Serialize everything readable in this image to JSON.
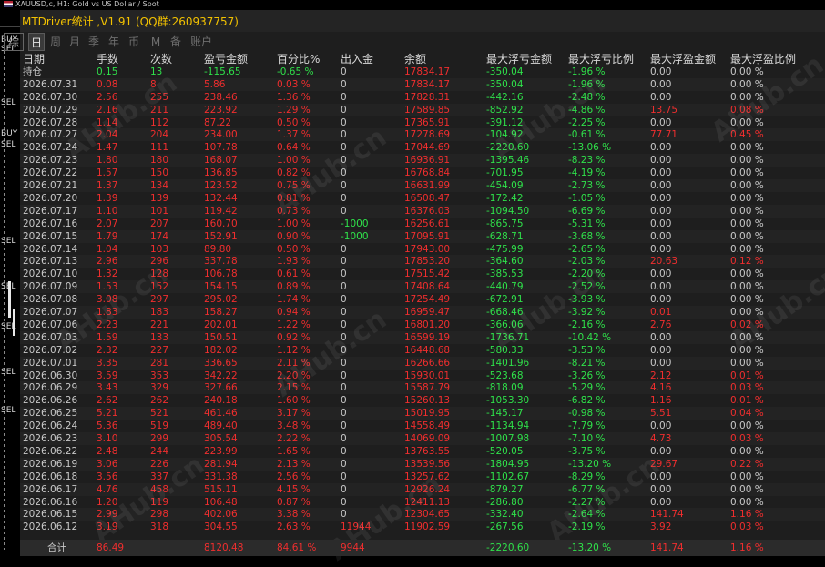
{
  "chart_header": "XAUUSD,c, H1:  Gold vs US Dollar / Spot",
  "side_labels": [
    "BUY",
    "SEL",
    "SEL",
    "BUY",
    "SEL",
    "SEL",
    "SEL",
    "SEL",
    "SEL",
    "SEL"
  ],
  "app_title": "MTDriver统计 ,V1.91 (QQ群:260937757)",
  "tabs": [
    "综",
    "日",
    "周",
    "月",
    "季",
    "年",
    "币",
    "M",
    "备",
    "账户"
  ],
  "active_tab": "日",
  "columns": [
    "日期",
    "手数",
    "次数",
    "盈亏金额",
    "百分比%",
    "出入金",
    "余额",
    "最大浮亏金额",
    "最大浮亏比例",
    "最大浮盈金额",
    "最大浮盈比例"
  ],
  "rows": [
    [
      "持仓",
      "0.15",
      "13",
      "-115.65",
      "-0.65 %",
      "0",
      "17834.17",
      "-350.04",
      "-1.96 %",
      "0.00",
      "0.00 %"
    ],
    [
      "2026.07.31",
      "0.08",
      "8",
      "5.86",
      "0.03 %",
      "0",
      "17834.17",
      "-350.04",
      "-1.96 %",
      "0.00",
      "0.00 %"
    ],
    [
      "2026.07.30",
      "2.56",
      "255",
      "238.46",
      "1.36 %",
      "0",
      "17828.31",
      "-442.16",
      "-2.48 %",
      "0.00",
      "0.00 %"
    ],
    [
      "2026.07.29",
      "2.16",
      "211",
      "223.92",
      "1.29 %",
      "0",
      "17589.85",
      "-852.92",
      "-4.86 %",
      "13.75",
      "0.08 %"
    ],
    [
      "2026.07.28",
      "1.14",
      "112",
      "87.22",
      "0.50 %",
      "0",
      "17365.91",
      "-391.12",
      "-2.25 %",
      "0.00",
      "0.00 %"
    ],
    [
      "2026.07.27",
      "2.04",
      "204",
      "234.00",
      "1.37 %",
      "0",
      "17278.69",
      "-104.92",
      "-0.61 %",
      "77.71",
      "0.45 %"
    ],
    [
      "2026.07.24",
      "1.47",
      "111",
      "107.78",
      "0.64 %",
      "0",
      "17044.69",
      "-2220.60",
      "-13.06 %",
      "0.00",
      "0.00 %"
    ],
    [
      "2026.07.23",
      "1.80",
      "180",
      "168.07",
      "1.00 %",
      "0",
      "16936.91",
      "-1395.46",
      "-8.23 %",
      "0.00",
      "0.00 %"
    ],
    [
      "2026.07.22",
      "1.57",
      "150",
      "136.85",
      "0.82 %",
      "0",
      "16768.84",
      "-701.95",
      "-4.19 %",
      "0.00",
      "0.00 %"
    ],
    [
      "2026.07.21",
      "1.37",
      "134",
      "123.52",
      "0.75 %",
      "0",
      "16631.99",
      "-454.09",
      "-2.73 %",
      "0.00",
      "0.00 %"
    ],
    [
      "2026.07.20",
      "1.39",
      "139",
      "132.44",
      "0.81 %",
      "0",
      "16508.47",
      "-172.42",
      "-1.05 %",
      "0.00",
      "0.00 %"
    ],
    [
      "2026.07.17",
      "1.10",
      "101",
      "119.42",
      "0.73 %",
      "0",
      "16376.03",
      "-1094.50",
      "-6.69 %",
      "0.00",
      "0.00 %"
    ],
    [
      "2026.07.16",
      "2.07",
      "207",
      "160.70",
      "1.00 %",
      "-1000",
      "16256.61",
      "-865.75",
      "-5.31 %",
      "0.00",
      "0.00 %"
    ],
    [
      "2026.07.15",
      "1.79",
      "174",
      "152.91",
      "0.90 %",
      "-1000",
      "17095.91",
      "-628.71",
      "-3.68 %",
      "0.00",
      "0.00 %"
    ],
    [
      "2026.07.14",
      "1.04",
      "103",
      "89.80",
      "0.50 %",
      "0",
      "17943.00",
      "-475.99",
      "-2.65 %",
      "0.00",
      "0.00 %"
    ],
    [
      "2026.07.13",
      "2.96",
      "296",
      "337.78",
      "1.93 %",
      "0",
      "17853.20",
      "-364.60",
      "-2.03 %",
      "20.63",
      "0.12 %"
    ],
    [
      "2026.07.10",
      "1.32",
      "128",
      "106.78",
      "0.61 %",
      "0",
      "17515.42",
      "-385.53",
      "-2.20 %",
      "0.00",
      "0.00 %"
    ],
    [
      "2026.07.09",
      "1.53",
      "152",
      "154.15",
      "0.89 %",
      "0",
      "17408.64",
      "-440.79",
      "-2.52 %",
      "0.00",
      "0.00 %"
    ],
    [
      "2026.07.08",
      "3.08",
      "297",
      "295.02",
      "1.74 %",
      "0",
      "17254.49",
      "-672.91",
      "-3.93 %",
      "0.00",
      "0.00 %"
    ],
    [
      "2026.07.07",
      "1.83",
      "183",
      "158.27",
      "0.94 %",
      "0",
      "16959.47",
      "-668.46",
      "-3.92 %",
      "0.01",
      "0.00 %"
    ],
    [
      "2026.07.06",
      "2.23",
      "221",
      "202.01",
      "1.22 %",
      "0",
      "16801.20",
      "-366.06",
      "-2.16 %",
      "2.76",
      "0.02 %"
    ],
    [
      "2026.07.03",
      "1.59",
      "133",
      "150.51",
      "0.92 %",
      "0",
      "16599.19",
      "-1736.71",
      "-10.42 %",
      "0.00",
      "0.00 %"
    ],
    [
      "2026.07.02",
      "2.32",
      "227",
      "182.02",
      "1.12 %",
      "0",
      "16448.68",
      "-580.33",
      "-3.53 %",
      "0.00",
      "0.00 %"
    ],
    [
      "2026.07.01",
      "3.35",
      "281",
      "336.65",
      "2.11 %",
      "0",
      "16266.66",
      "-1401.96",
      "-8.21 %",
      "0.00",
      "0.00 %"
    ],
    [
      "2026.06.30",
      "3.59",
      "353",
      "342.22",
      "2.20 %",
      "0",
      "15930.01",
      "-523.68",
      "-3.26 %",
      "2.12",
      "0.01 %"
    ],
    [
      "2026.06.29",
      "3.43",
      "329",
      "327.66",
      "2.15 %",
      "0",
      "15587.79",
      "-818.09",
      "-5.29 %",
      "4.16",
      "0.03 %"
    ],
    [
      "2026.06.26",
      "2.62",
      "262",
      "240.18",
      "1.60 %",
      "0",
      "15260.13",
      "-1053.30",
      "-6.82 %",
      "1.16",
      "0.01 %"
    ],
    [
      "2026.06.25",
      "5.21",
      "521",
      "461.46",
      "3.17 %",
      "0",
      "15019.95",
      "-145.17",
      "-0.98 %",
      "5.51",
      "0.04 %"
    ],
    [
      "2026.06.24",
      "5.36",
      "519",
      "489.40",
      "3.48 %",
      "0",
      "14558.49",
      "-1134.94",
      "-7.79 %",
      "0.00",
      "0.00 %"
    ],
    [
      "2026.06.23",
      "3.10",
      "299",
      "305.54",
      "2.22 %",
      "0",
      "14069.09",
      "-1007.98",
      "-7.10 %",
      "4.73",
      "0.03 %"
    ],
    [
      "2026.06.22",
      "2.48",
      "244",
      "223.99",
      "1.65 %",
      "0",
      "13763.55",
      "-520.05",
      "-3.75 %",
      "0.00",
      "0.00 %"
    ],
    [
      "2026.06.19",
      "3.06",
      "226",
      "281.94",
      "2.13 %",
      "0",
      "13539.56",
      "-1804.95",
      "-13.20 %",
      "29.67",
      "0.22 %"
    ],
    [
      "2026.06.18",
      "3.56",
      "337",
      "331.38",
      "2.56 %",
      "0",
      "13257.62",
      "-1102.67",
      "-8.29 %",
      "0.00",
      "0.00 %"
    ],
    [
      "2026.06.17",
      "4.76",
      "458",
      "515.11",
      "4.15 %",
      "0",
      "12926.24",
      "-879.27",
      "-6.77 %",
      "0.00",
      "0.00 %"
    ],
    [
      "2026.06.16",
      "1.20",
      "119",
      "106.48",
      "0.87 %",
      "0",
      "12411.13",
      "-286.80",
      "-2.27 %",
      "0.00",
      "0.00 %"
    ],
    [
      "2026.06.15",
      "2.99",
      "298",
      "402.06",
      "3.38 %",
      "0",
      "12304.65",
      "-332.40",
      "-2.64 %",
      "141.74",
      "1.16 %"
    ],
    [
      "2026.06.12",
      "3.19",
      "318",
      "304.55",
      "2.63 %",
      "11944",
      "11902.59",
      "-267.56",
      "-2.19 %",
      "3.92",
      "0.03 %"
    ]
  ],
  "total": [
    "合计",
    "86.49",
    "",
    "8120.48",
    "84.61 %",
    "9944",
    "",
    "-2220.60",
    "-13.20 %",
    "141.74",
    "1.16 %"
  ],
  "watermark": "AHub.cn",
  "colors": {
    "background": "#1e1e1e",
    "positive": "#ef2e2e",
    "negative": "#2fe04a",
    "neutral": "#c8c8c8",
    "title": "#f2c100"
  }
}
